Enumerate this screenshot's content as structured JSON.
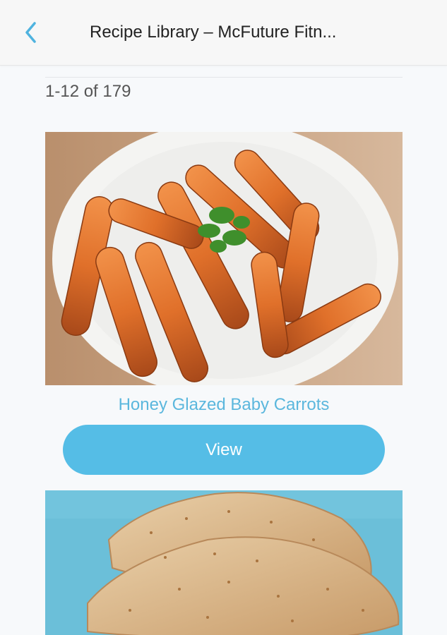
{
  "header": {
    "title": "Recipe Library – McFuture Fitn...",
    "back_icon": "chevron-left-icon"
  },
  "results": {
    "count_text": "1-12 of 179"
  },
  "recipes": [
    {
      "title": "Honey Glazed Baby Carrots",
      "view_label": "View",
      "image": "glazed-carrots-photo"
    },
    {
      "title": "",
      "image": "breaded-chicken-photo"
    }
  ],
  "colors": {
    "accent": "#55bde6",
    "link": "#5bb7dd",
    "background": "#f7f9fb"
  }
}
